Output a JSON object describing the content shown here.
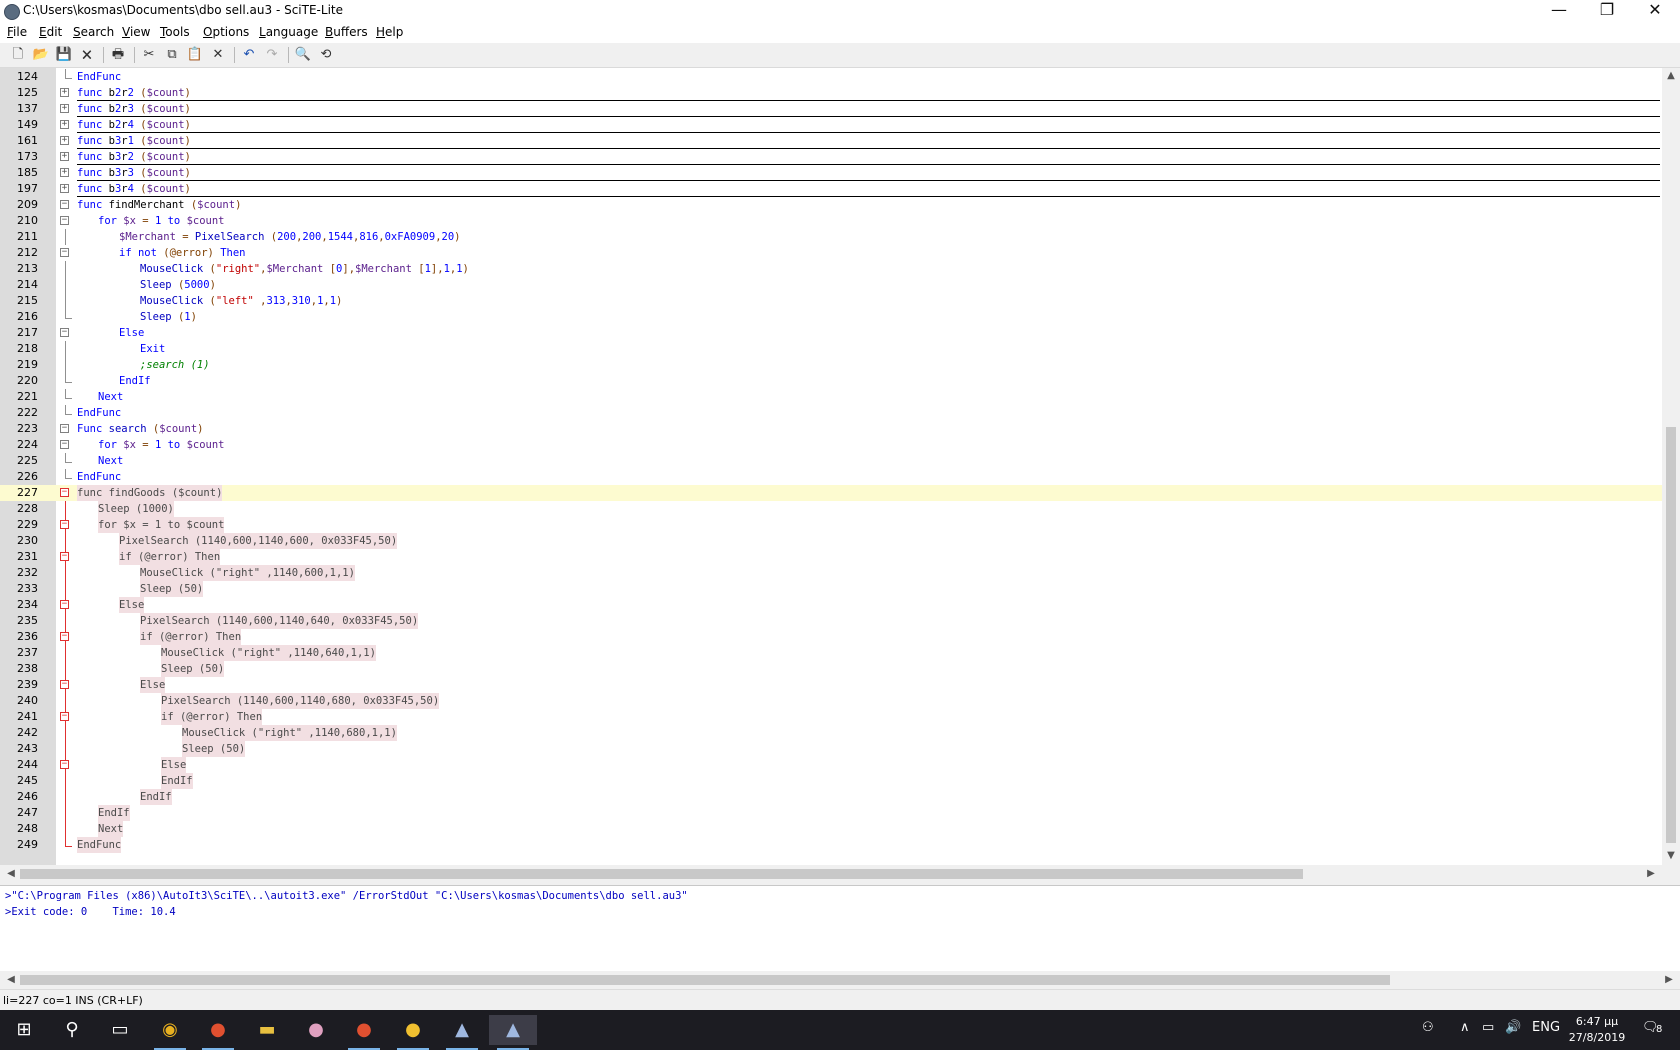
{
  "window": {
    "title": "C:\\Users\\kosmas\\Documents\\dbo sell.au3 - SciTE-Lite",
    "minimize": "—",
    "restore": "❐",
    "close": "✕"
  },
  "menu": [
    "File",
    "Edit",
    "Search",
    "View",
    "Tools",
    "Options",
    "Language",
    "Buffers",
    "Help"
  ],
  "toolbar_icons": [
    "new-file-icon",
    "open-folder-icon",
    "save-icon",
    "close-file-icon",
    "print-icon",
    "cut-icon",
    "copy-icon",
    "paste-icon",
    "delete-icon",
    "undo-icon",
    "redo-icon",
    "find-icon",
    "replace-icon"
  ],
  "editor": {
    "current_line": "227",
    "lines": [
      {
        "n": "124",
        "fold": "end",
        "indent": 0,
        "code": "EndFunc"
      },
      {
        "n": "125",
        "fold": "plus",
        "indent": 0,
        "code": "func b2r2 ($count)",
        "collapsed": true
      },
      {
        "n": "137",
        "fold": "plus",
        "indent": 0,
        "code": "func b2r3 ($count)",
        "collapsed": true
      },
      {
        "n": "149",
        "fold": "plus",
        "indent": 0,
        "code": "func b2r4 ($count)",
        "collapsed": true
      },
      {
        "n": "161",
        "fold": "plus",
        "indent": 0,
        "code": "func b3r1 ($count)",
        "collapsed": true
      },
      {
        "n": "173",
        "fold": "plus",
        "indent": 0,
        "code": "func b3r2 ($count)",
        "collapsed": true
      },
      {
        "n": "185",
        "fold": "plus",
        "indent": 0,
        "code": "func b3r3 ($count)",
        "collapsed": true
      },
      {
        "n": "197",
        "fold": "plus",
        "indent": 0,
        "code": "func b3r4 ($count)",
        "collapsed": true
      },
      {
        "n": "209",
        "fold": "minus",
        "indent": 0,
        "code": "func findMerchant ($count)"
      },
      {
        "n": "210",
        "fold": "minus",
        "indent": 1,
        "code": "for $x = 1 to $count"
      },
      {
        "n": "211",
        "fold": "line",
        "indent": 2,
        "code": "$Merchant = PixelSearch (200,200,1544,816,0xFA0909,20)"
      },
      {
        "n": "212",
        "fold": "minus",
        "indent": 2,
        "code": "if not (@error) Then"
      },
      {
        "n": "213",
        "fold": "line",
        "indent": 3,
        "code": "MouseClick (\"right\",$Merchant [0],$Merchant [1],1,1)"
      },
      {
        "n": "214",
        "fold": "line",
        "indent": 3,
        "code": "Sleep (5000)"
      },
      {
        "n": "215",
        "fold": "line",
        "indent": 3,
        "code": "MouseClick (\"left\" ,313,310,1,1)"
      },
      {
        "n": "216",
        "fold": "end",
        "indent": 3,
        "code": "Sleep (1)"
      },
      {
        "n": "217",
        "fold": "minus",
        "indent": 2,
        "code": "Else"
      },
      {
        "n": "218",
        "fold": "line",
        "indent": 3,
        "code": "Exit"
      },
      {
        "n": "219",
        "fold": "line",
        "indent": 3,
        "code": ";search (1)",
        "comment": true
      },
      {
        "n": "220",
        "fold": "end",
        "indent": 2,
        "code": "EndIf"
      },
      {
        "n": "221",
        "fold": "end",
        "indent": 1,
        "code": "Next"
      },
      {
        "n": "222",
        "fold": "end",
        "indent": 0,
        "code": "EndFunc"
      },
      {
        "n": "223",
        "fold": "minus",
        "indent": 0,
        "code": "Func search ($count)"
      },
      {
        "n": "224",
        "fold": "minus",
        "indent": 1,
        "code": "for $x = 1 to $count"
      },
      {
        "n": "225",
        "fold": "end",
        "indent": 1,
        "code": "Next"
      },
      {
        "n": "226",
        "fold": "end",
        "indent": 0,
        "code": "EndFunc"
      },
      {
        "n": "227",
        "fold": "minus",
        "indent": 0,
        "code": "func findGoods ($count)",
        "hl": true,
        "red": true
      },
      {
        "n": "228",
        "fold": "line",
        "indent": 1,
        "code": "Sleep (1000)",
        "hl": true,
        "red": true
      },
      {
        "n": "229",
        "fold": "minus",
        "indent": 1,
        "code": "for $x = 1 to $count",
        "hl": true,
        "red": true
      },
      {
        "n": "230",
        "fold": "line",
        "indent": 2,
        "code": "PixelSearch (1140,600,1140,600, 0x033F45,50)",
        "hl": true,
        "red": true
      },
      {
        "n": "231",
        "fold": "minus",
        "indent": 2,
        "code": "if (@error) Then",
        "hl": true,
        "red": true
      },
      {
        "n": "232",
        "fold": "line",
        "indent": 3,
        "code": "MouseClick (\"right\" ,1140,600,1,1)",
        "hl": true,
        "red": true
      },
      {
        "n": "233",
        "fold": "line",
        "indent": 3,
        "code": "Sleep (50)",
        "hl": true,
        "red": true
      },
      {
        "n": "234",
        "fold": "minus",
        "indent": 2,
        "code": "Else",
        "hl": true,
        "red": true
      },
      {
        "n": "235",
        "fold": "line",
        "indent": 3,
        "code": "PixelSearch (1140,600,1140,640, 0x033F45,50)",
        "hl": true,
        "red": true
      },
      {
        "n": "236",
        "fold": "minus",
        "indent": 3,
        "code": "if (@error) Then",
        "hl": true,
        "red": true
      },
      {
        "n": "237",
        "fold": "line",
        "indent": 4,
        "code": "MouseClick (\"right\" ,1140,640,1,1)",
        "hl": true,
        "red": true
      },
      {
        "n": "238",
        "fold": "line",
        "indent": 4,
        "code": "Sleep (50)",
        "hl": true,
        "red": true
      },
      {
        "n": "239",
        "fold": "minus",
        "indent": 3,
        "code": "Else",
        "hl": true,
        "red": true
      },
      {
        "n": "240",
        "fold": "line",
        "indent": 4,
        "code": "PixelSearch (1140,600,1140,680, 0x033F45,50)",
        "hl": true,
        "red": true
      },
      {
        "n": "241",
        "fold": "minus",
        "indent": 4,
        "code": "if (@error) Then",
        "hl": true,
        "red": true
      },
      {
        "n": "242",
        "fold": "line",
        "indent": 5,
        "code": "MouseClick (\"right\" ,1140,680,1,1)",
        "hl": true,
        "red": true
      },
      {
        "n": "243",
        "fold": "line",
        "indent": 5,
        "code": "Sleep (50)",
        "hl": true,
        "red": true
      },
      {
        "n": "244",
        "fold": "minus",
        "indent": 4,
        "code": "Else",
        "hl": true,
        "red": true
      },
      {
        "n": "245",
        "fold": "line",
        "indent": 4,
        "code": "EndIf",
        "hl": true,
        "red": true
      },
      {
        "n": "246",
        "fold": "line",
        "indent": 3,
        "code": "EndIf",
        "hl": true,
        "red": true
      },
      {
        "n": "247",
        "fold": "line",
        "indent": 1,
        "code": "EndIf",
        "hl": true,
        "red": true
      },
      {
        "n": "248",
        "fold": "line",
        "indent": 1,
        "code": "Next",
        "hl": true,
        "red": true
      },
      {
        "n": "249",
        "fold": "end",
        "indent": 0,
        "code": "EndFunc",
        "hl": true,
        "red": true
      }
    ]
  },
  "output": {
    "line1": ">\"C:\\Program Files (x86)\\AutoIt3\\SciTE\\..\\autoit3.exe\" /ErrorStdOut \"C:\\Users\\kosmas\\Documents\\dbo sell.au3\"",
    "line2": ">Exit code: 0    Time: 10.4"
  },
  "status": "li=227 co=1 INS (CR+LF)",
  "taskbar": {
    "apps": [
      "start-icon",
      "search-icon",
      "task-view-icon",
      "chrome-icon",
      "game-app-icon",
      "file-explorer-icon",
      "avatar-app-icon",
      "game-app-2-icon",
      "game-app-3-icon",
      "autoit-icon",
      "scite-icon"
    ],
    "language": "ENG",
    "time": "6:47 μμ",
    "date": "27/8/2019",
    "notification_count": "8"
  }
}
